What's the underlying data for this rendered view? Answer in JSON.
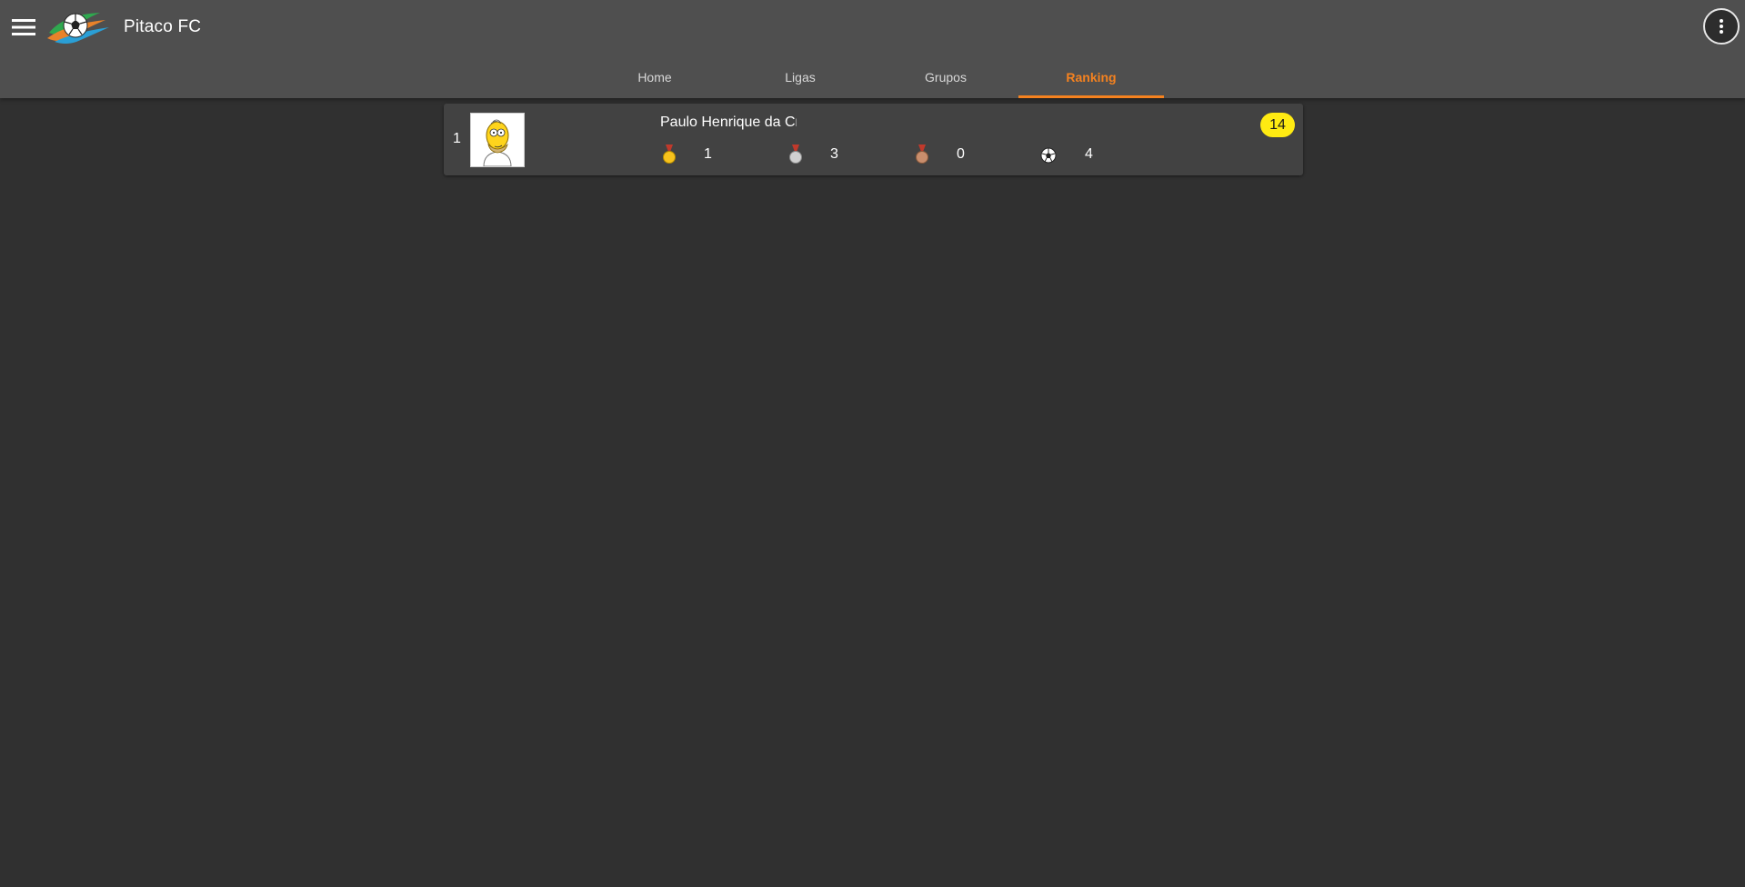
{
  "app": {
    "title": "Pitaco FC",
    "logo_icon": "soccer-ball-logo-icon",
    "menu_icon": "hamburger-menu-icon",
    "more_icon": "more-vertical-icon"
  },
  "tabs": [
    {
      "label": "Home",
      "active": false
    },
    {
      "label": "Ligas",
      "active": false
    },
    {
      "label": "Grupos",
      "active": false
    },
    {
      "label": "Ranking",
      "active": true
    }
  ],
  "colors": {
    "appbar": "#4f4f4f",
    "background": "#303030",
    "card": "#424242",
    "accent": "#f5821f",
    "score_badge": "#ffeb12"
  },
  "ranking": [
    {
      "position": "1",
      "avatar_icon": "homer-avatar-icon",
      "name": "Paulo Henrique da Cr",
      "score": "14",
      "stats": {
        "gold_medals": "1",
        "silver_medals": "3",
        "bronze_medals": "0",
        "goals": "4"
      }
    }
  ]
}
